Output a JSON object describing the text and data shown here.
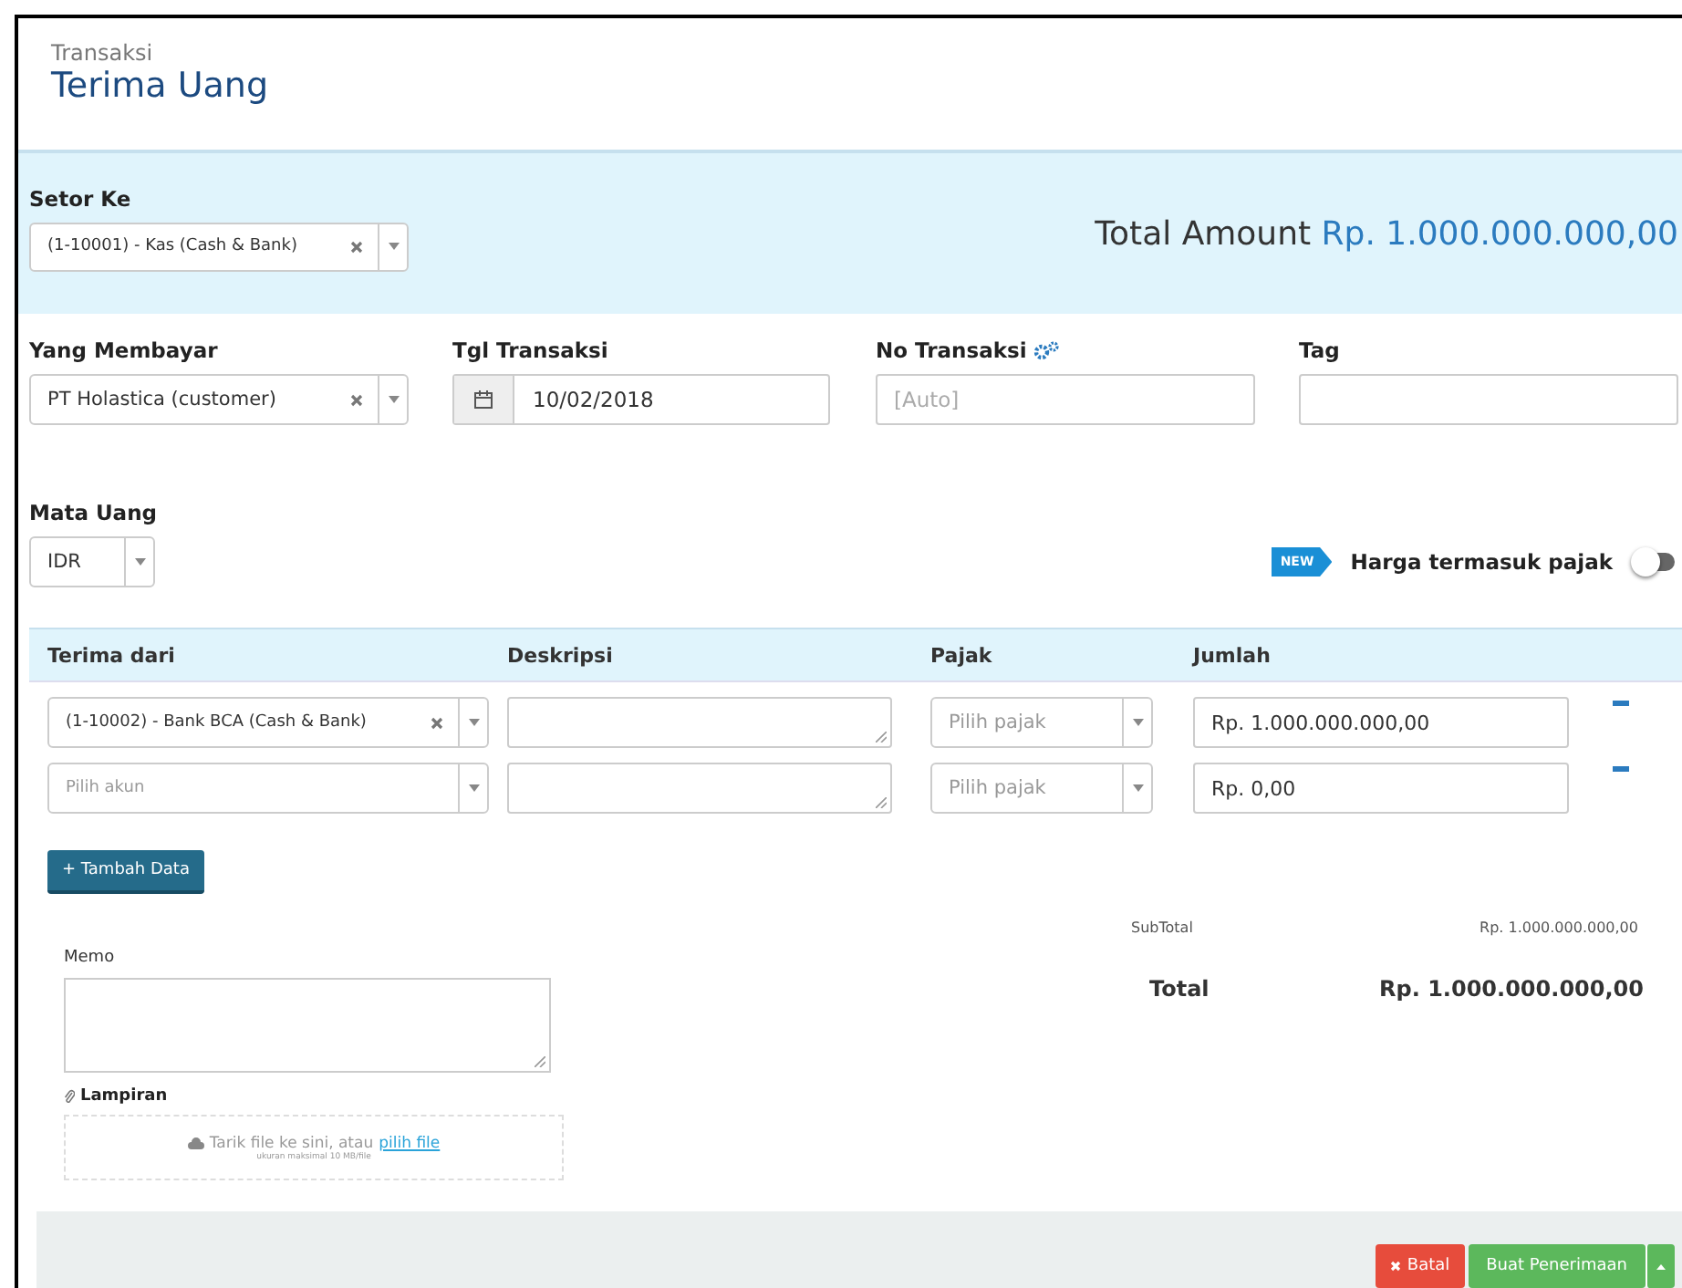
{
  "header": {
    "breadcrumb": "Transaksi",
    "title": "Terima Uang"
  },
  "deposit": {
    "label": "Setor Ke",
    "value": "(1-10001) - Kas (Cash & Bank)",
    "total_label": "Total Amount",
    "total_value": "Rp. 1.000.000.000,00"
  },
  "payer": {
    "label": "Yang Membayar",
    "value": "PT Holastica (customer)"
  },
  "date": {
    "label": "Tgl Transaksi",
    "value": "10/02/2018"
  },
  "number": {
    "label": "No Transaksi",
    "placeholder": "[Auto]"
  },
  "tag": {
    "label": "Tag"
  },
  "currency": {
    "label": "Mata Uang",
    "value": "IDR"
  },
  "tax_toggle": {
    "badge": "NEW",
    "label": "Harga termasuk pajak",
    "on": false
  },
  "table": {
    "columns": [
      "Terima dari",
      "Deskripsi",
      "Pajak",
      "Jumlah"
    ],
    "rows": [
      {
        "account": "(1-10002) - Bank BCA (Cash & Bank)",
        "account_placeholder": null,
        "tax_placeholder": "Pilih pajak",
        "amount": "Rp. 1.000.000.000,00"
      },
      {
        "account": null,
        "account_placeholder": "Pilih akun",
        "tax_placeholder": "Pilih pajak",
        "amount": "Rp. 0,00"
      }
    ]
  },
  "add_button": "+ Tambah Data",
  "memo": {
    "label": "Memo"
  },
  "attachment": {
    "label": "Lampiran",
    "drop_text": "Tarik file ke sini, atau",
    "link": "pilih file",
    "hint": "ukuran maksimal 10 MB/file"
  },
  "summary": {
    "subtotal_label": "SubTotal",
    "subtotal_value": "Rp. 1.000.000.000,00",
    "total_label": "Total",
    "total_value": "Rp. 1.000.000.000,00"
  },
  "footer": {
    "cancel": "Batal",
    "submit": "Buat Penerimaan"
  }
}
